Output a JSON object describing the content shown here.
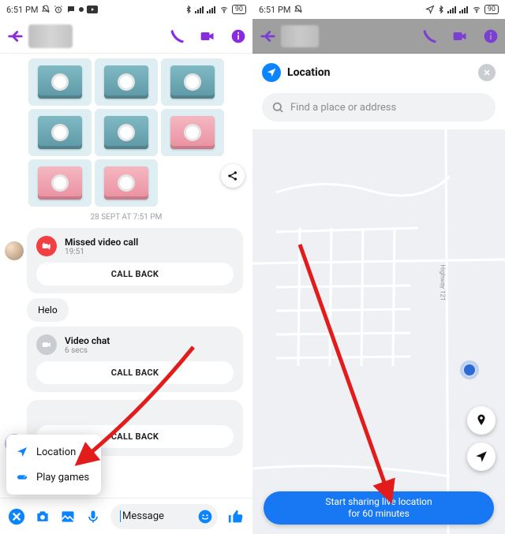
{
  "status": {
    "time": "6:51 PM",
    "battery": "90"
  },
  "chat": {
    "timestamp": "28 SEPT AT 7:51 PM",
    "missed_call_title": "Missed video call",
    "missed_call_time": "19:51",
    "callback_label": "CALL BACK",
    "helo": "Helo",
    "video_chat_title": "Video chat",
    "video_chat_sub": "6 secs"
  },
  "composer": {
    "placeholder": "Message"
  },
  "popup": {
    "location_label": "Location",
    "games_label": "Play games"
  },
  "location": {
    "title": "Location",
    "search_placeholder": "Find a place or address",
    "road_name": "Highway 121",
    "share_line1": "Start sharing live location",
    "share_line2": "for 60 minutes"
  }
}
